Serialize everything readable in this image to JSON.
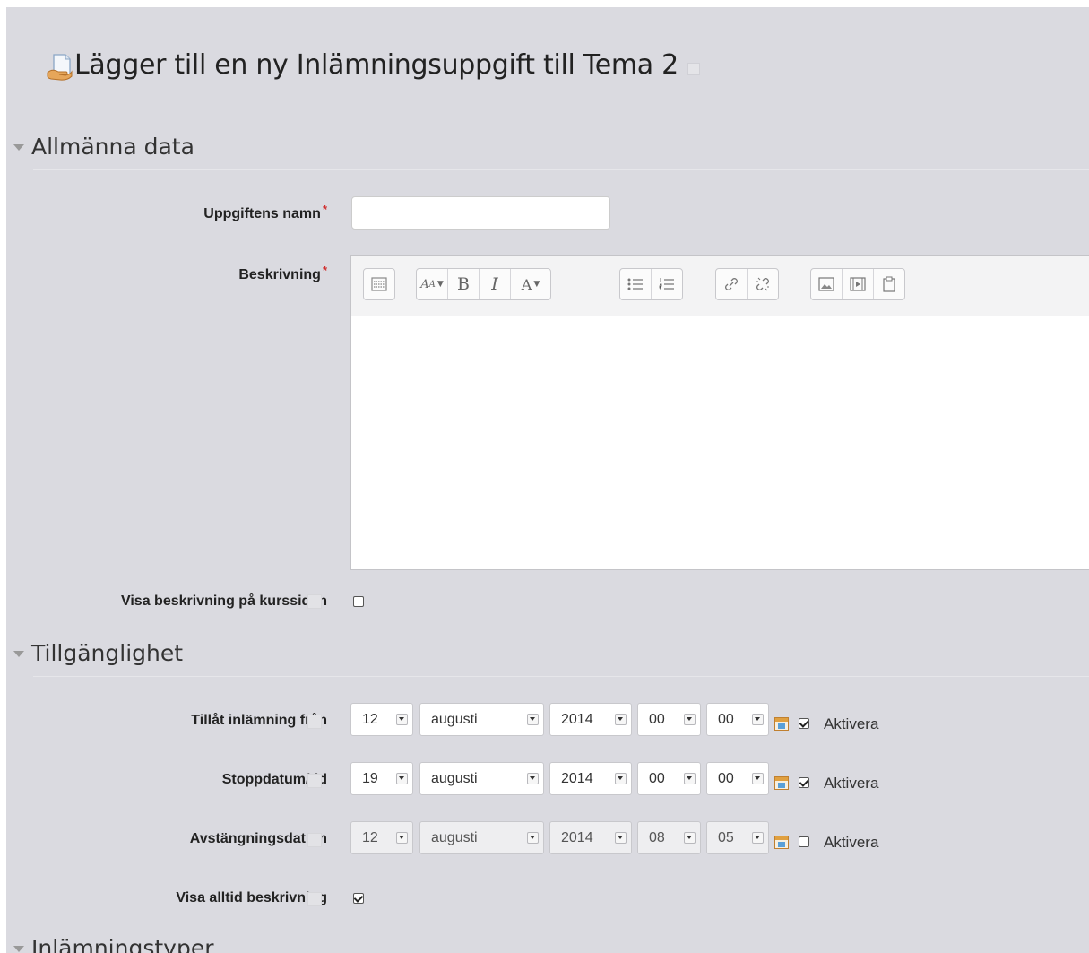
{
  "page": {
    "title": "Lägger till en ny Inlämningsuppgift till Tema 2",
    "title_icon": "assignment-icon"
  },
  "sections": [
    {
      "label": "Allmänna data",
      "expanded": true
    },
    {
      "label": "Tillgänglighet",
      "expanded": true
    },
    {
      "label": "Inlämningstyper",
      "expanded": true
    }
  ],
  "general": {
    "name_label": "Uppgiftens namn",
    "name_value": "",
    "required_mark": "*",
    "description_label": "Beskrivning",
    "show_description_label": "Visa beskrivning på kurssidan",
    "show_description_checked": false
  },
  "editor": {
    "toolbar_groups": [
      [
        "toolbar-toggle-icon"
      ],
      [
        "font-size-icon",
        "bold-icon",
        "italic-icon",
        "font-color-icon"
      ],
      [
        "unordered-list-icon",
        "ordered-list-icon"
      ],
      [
        "link-icon",
        "unlink-icon"
      ],
      [
        "image-icon",
        "media-icon",
        "paste-icon"
      ]
    ],
    "content": ""
  },
  "availability": {
    "enable_label": "Aktivera",
    "rows": [
      {
        "label": "Tillåt inlämning från",
        "day": "12",
        "month": "augusti",
        "year": "2014",
        "hour": "00",
        "minute": "00",
        "enabled": true
      },
      {
        "label": "Stoppdatum/tid",
        "day": "19",
        "month": "augusti",
        "year": "2014",
        "hour": "00",
        "minute": "00",
        "enabled": true
      },
      {
        "label": "Avstängningsdatum",
        "day": "12",
        "month": "augusti",
        "year": "2014",
        "hour": "08",
        "minute": "05",
        "enabled": false
      }
    ],
    "always_show_label": "Visa alltid beskrivning",
    "always_show_checked": true
  },
  "colors": {
    "background": "#dadae0",
    "required": "#d03030"
  }
}
